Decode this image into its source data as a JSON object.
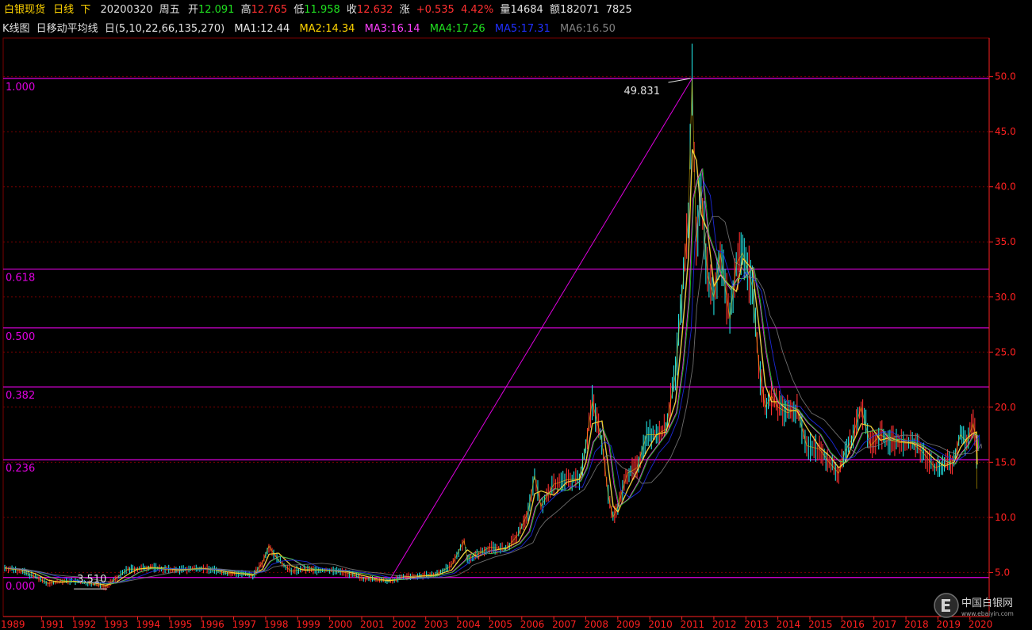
{
  "header": {
    "symbol": "白银现货",
    "period": "日线",
    "arrow": "下",
    "date": "20200320",
    "weekday": "周五",
    "open_label": "开",
    "open": "12.091",
    "high_label": "高",
    "high": "12.765",
    "low_label": "低",
    "low": "11.958",
    "close_label": "收",
    "close": "12.632",
    "change_label": "涨",
    "change": "+0.535",
    "change_pct": "4.42%",
    "volume_label": "量",
    "volume": "14684",
    "amount_label": "额",
    "amount": "182071",
    "extra": "7825"
  },
  "ma_bar": {
    "chart_name": "K线图",
    "indicator": "日移动平均线",
    "params": "日(5,10,22,66,135,270)",
    "ma": [
      {
        "label": "MA1:12.44",
        "color": "#e8e8e8"
      },
      {
        "label": "MA2:14.34",
        "color": "#ffd400"
      },
      {
        "label": "MA3:16.14",
        "color": "#ff40ff"
      },
      {
        "label": "MA4:17.26",
        "color": "#20e020"
      },
      {
        "label": "MA5:17.31",
        "color": "#2030ff"
      },
      {
        "label": "MA6:16.50",
        "color": "#808080"
      }
    ]
  },
  "colors": {
    "axis": "#ff2020",
    "grid": "#7a0000",
    "fib": "#e000e0",
    "up": "#ff3030",
    "down": "#20e0e0",
    "text_white": "#e0e0e0"
  },
  "chart_data": {
    "type": "line",
    "title": "白银现货 日线",
    "ylim": [
      1.0,
      53.5
    ],
    "xlim": [
      1989.8,
      2020.6
    ],
    "yticks": [
      5.0,
      10.0,
      15.0,
      20.0,
      25.0,
      30.0,
      35.0,
      40.0,
      45.0,
      50.0
    ],
    "ytick_labels": [
      "5.0",
      "10.0",
      "15.0",
      "20.0",
      "25.0",
      "30.0",
      "35.0",
      "40.0",
      "45.0",
      "50.0"
    ],
    "xticks": [
      1991,
      1992,
      1993,
      1994,
      1995,
      1996,
      1997,
      1998,
      1999,
      2000,
      2001,
      2002,
      2003,
      2004,
      2005,
      2006,
      2007,
      2008,
      2009,
      2010,
      2011,
      2012,
      2013,
      2014,
      2015,
      2016,
      2017,
      2018,
      2019,
      2020
    ],
    "xtick_labels": [
      "1991",
      "1992",
      "1993",
      "1994",
      "1995",
      "1996",
      "1997",
      "1998",
      "1999",
      "2000",
      "2001",
      "2002",
      "2003",
      "2004",
      "2005",
      "2006",
      "2007",
      "2008",
      "2009",
      "2010",
      "2011",
      "2012",
      "2013",
      "2014",
      "2015",
      "2016",
      "2017",
      "2018",
      "2019",
      "2020"
    ],
    "xtick_overlap_label": "1989",
    "series": [
      {
        "x": [
          1989.85,
          1990.3,
          1990.8,
          1991.2,
          1991.6,
          1992.0,
          1992.5,
          1993.0,
          1993.3,
          1993.7,
          1994.0,
          1994.4,
          1994.8,
          1995.2,
          1995.6,
          1996.0,
          1996.4,
          1996.8,
          1997.2,
          1997.6,
          1997.9,
          1998.1,
          1998.4,
          1998.8,
          1999.2,
          1999.6,
          2000.0,
          2000.5,
          2001.0,
          2001.5,
          2001.85,
          2002.3,
          2002.8,
          2003.3,
          2003.8,
          2004.2,
          2004.3,
          2004.6,
          2005.0,
          2005.5,
          2005.9,
          2006.2,
          2006.4,
          2006.6,
          2007.0,
          2007.4,
          2007.8,
          2008.0,
          2008.2,
          2008.5,
          2008.7,
          2008.85,
          2009.0,
          2009.3,
          2009.6,
          2009.9,
          2010.2,
          2010.5,
          2010.8,
          2011.0,
          2011.2,
          2011.32,
          2011.45,
          2011.6,
          2011.8,
          2012.0,
          2012.2,
          2012.5,
          2012.7,
          2012.9,
          2013.2,
          2013.4,
          2013.6,
          2013.8,
          2014.0,
          2014.3,
          2014.6,
          2014.9,
          2015.3,
          2015.6,
          2015.9,
          2016.1,
          2016.3,
          2016.6,
          2016.9,
          2017.2,
          2017.5,
          2017.8,
          2018.2,
          2018.5,
          2018.9,
          2019.2,
          2019.5,
          2019.7,
          2019.9,
          2020.1,
          2020.2,
          2020.22
        ],
        "values": [
          5.4,
          5.2,
          4.6,
          4.0,
          4.2,
          4.2,
          4.0,
          3.7,
          4.4,
          5.3,
          5.3,
          5.5,
          5.3,
          5.2,
          5.3,
          5.4,
          5.2,
          4.9,
          4.9,
          4.7,
          5.9,
          7.4,
          6.1,
          5.1,
          5.3,
          5.2,
          5.2,
          5.0,
          4.5,
          4.3,
          4.2,
          4.6,
          4.7,
          4.8,
          5.6,
          7.9,
          6.2,
          6.6,
          7.3,
          7.1,
          8.5,
          10.5,
          13.8,
          11.0,
          13.0,
          13.4,
          13.5,
          16.5,
          20.5,
          17.0,
          12.0,
          10.0,
          11.0,
          14.0,
          14.5,
          17.5,
          17.5,
          18.0,
          23.0,
          30.0,
          37.0,
          49.8,
          35.0,
          40.0,
          32.0,
          30.0,
          34.0,
          28.0,
          33.0,
          34.0,
          31.0,
          24.0,
          20.0,
          21.0,
          20.0,
          19.5,
          19.8,
          16.5,
          16.2,
          15.0,
          14.0,
          16.0,
          17.0,
          20.0,
          16.5,
          17.5,
          17.0,
          16.8,
          16.7,
          16.0,
          14.5,
          14.8,
          15.2,
          17.5,
          16.8,
          18.5,
          17.0,
          12.6
        ]
      }
    ],
    "fibonacci": {
      "levels": [
        {
          "label": "1.000",
          "value": 49.831
        },
        {
          "label": "0.618",
          "value": 32.53
        },
        {
          "label": "0.500",
          "value": 27.19
        },
        {
          "label": "0.382",
          "value": 21.84
        },
        {
          "label": "0.236",
          "value": 15.23
        },
        {
          "label": "0.000",
          "value": 4.54
        }
      ],
      "trend_line": {
        "x1": 2001.85,
        "y1": 4.2,
        "x2": 2011.32,
        "y2": 49.831
      }
    },
    "annotations": [
      {
        "text": "49.831",
        "x": 2011.32,
        "y": 49.831
      },
      {
        "text": "3.510",
        "x": 1993.0,
        "y": 3.51
      }
    ]
  },
  "watermark": {
    "site_name": "中国白银网",
    "url": "www.ebaiyin.com"
  }
}
